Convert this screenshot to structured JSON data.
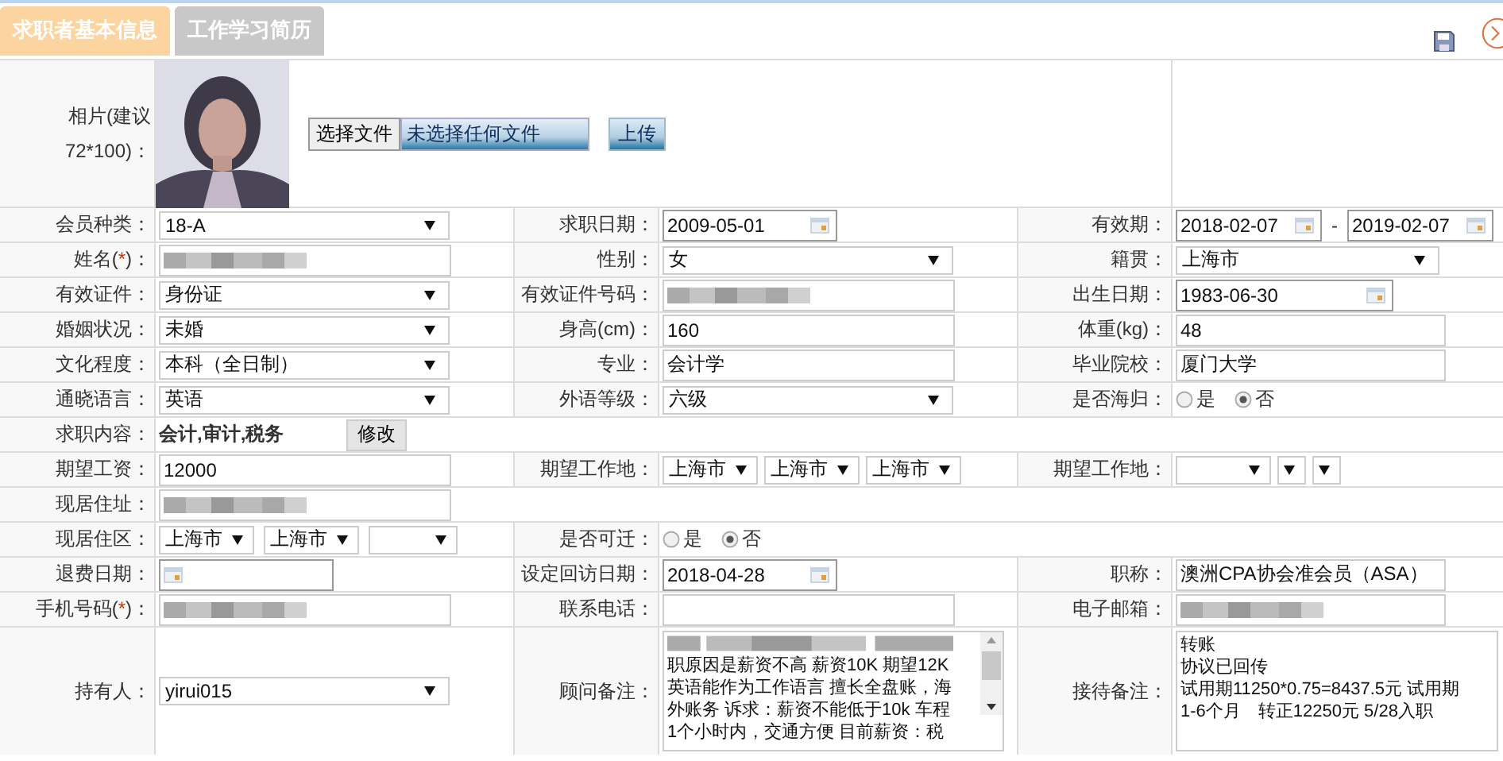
{
  "tabs": [
    {
      "label": "求职者基本信息",
      "selected": true
    },
    {
      "label": "工作学习简历",
      "selected": false
    }
  ],
  "photo": {
    "label_lines": [
      "相片(建议",
      "72*100)："
    ],
    "choose_button": "选择文件",
    "file_status": "未选择任何文件",
    "upload_button": "上传"
  },
  "rows": [
    [
      {
        "label": "会员种类：",
        "field": {
          "kind": "select",
          "value": "18-A"
        }
      },
      {
        "label": "求职日期：",
        "field": {
          "kind": "date",
          "value": "2009-05-01"
        }
      },
      {
        "label": "有效期：",
        "field": {
          "kind": "daterange",
          "from": "2018-02-07",
          "sep": "-",
          "to": "2019-02-07"
        }
      }
    ],
    [
      {
        "label": "姓名(",
        "required_mark": "*",
        "label_end": ")：",
        "field": {
          "kind": "redacted"
        }
      },
      {
        "label": "性别：",
        "field": {
          "kind": "select",
          "value": "女"
        }
      },
      {
        "label": "籍贯：",
        "field": {
          "kind": "select",
          "value": "上海市"
        }
      }
    ],
    [
      {
        "label": "有效证件：",
        "field": {
          "kind": "select",
          "value": "身份证"
        }
      },
      {
        "label": "有效证件号码：",
        "field": {
          "kind": "redacted"
        }
      },
      {
        "label": "出生日期：",
        "field": {
          "kind": "date",
          "value": "1983-06-30"
        }
      }
    ],
    [
      {
        "label": "婚姻状况：",
        "field": {
          "kind": "select",
          "value": "未婚"
        }
      },
      {
        "label": "身高(cm)：",
        "field": {
          "kind": "input",
          "value": "160"
        }
      },
      {
        "label": "体重(kg)：",
        "field": {
          "kind": "input",
          "value": "48"
        }
      }
    ],
    [
      {
        "label": "文化程度：",
        "field": {
          "kind": "select",
          "value": "本科（全日制）"
        }
      },
      {
        "label": "专业：",
        "field": {
          "kind": "input",
          "value": "会计学"
        }
      },
      {
        "label": "毕业院校：",
        "field": {
          "kind": "input",
          "value": "厦门大学"
        }
      }
    ],
    [
      {
        "label": "通晓语言：",
        "field": {
          "kind": "select",
          "value": "英语"
        }
      },
      {
        "label": "外语等级：",
        "field": {
          "kind": "select",
          "value": "六级"
        }
      },
      {
        "label": "是否海归：",
        "field": {
          "kind": "radio",
          "options": [
            {
              "label": "是",
              "selected": false
            },
            {
              "label": "否",
              "selected": true
            }
          ]
        }
      }
    ],
    [
      {
        "label": "求职内容：",
        "field": {
          "kind": "text_button",
          "text": "会计,审计,税务",
          "button": "修改"
        }
      }
    ],
    [
      {
        "label": "期望工资：",
        "field": {
          "kind": "input",
          "value": "12000"
        }
      },
      {
        "label": "期望工作地：",
        "field": {
          "kind": "selects",
          "items": [
            {
              "value": "上海市"
            },
            {
              "value": "上海市"
            },
            {
              "value": "上海市"
            }
          ]
        }
      },
      {
        "label": "期望工作地：",
        "field": {
          "kind": "selects",
          "items": [
            {
              "empty": true
            },
            {
              "empty": true
            },
            {
              "empty": true
            }
          ]
        }
      }
    ],
    [
      {
        "label": "现居住址：",
        "field": {
          "kind": "redacted"
        }
      }
    ],
    [
      {
        "label": "现居住区：",
        "field": {
          "kind": "selects",
          "items": [
            {
              "value": "上海市"
            },
            {
              "value": "上海市"
            },
            {
              "empty": true
            }
          ]
        }
      },
      {
        "label": "是否可迁：",
        "field": {
          "kind": "radio",
          "options": [
            {
              "label": "是",
              "selected": false
            },
            {
              "label": "否",
              "selected": true
            }
          ]
        }
      }
    ],
    [
      {
        "label": "退费日期：",
        "field": {
          "kind": "date"
        }
      },
      {
        "label": "设定回访日期：",
        "field": {
          "kind": "date",
          "value": "2018-04-28"
        }
      },
      {
        "label": "职称：",
        "field": {
          "kind": "input",
          "value": "澳洲CPA协会准会员（ASA）"
        }
      }
    ],
    [
      {
        "label": "手机号码(",
        "required_mark": "*",
        "label_end": ")：",
        "field": {
          "kind": "redacted"
        }
      },
      {
        "label": "联系电话：",
        "field": {
          "kind": "input"
        }
      },
      {
        "label": "电子邮箱：",
        "field": {
          "kind": "redacted"
        }
      }
    ],
    [
      {
        "label": "持有人：",
        "field": {
          "kind": "select",
          "value": "yirui015"
        }
      },
      {
        "label": "顾问备注：",
        "field": {
          "kind": "textarea",
          "redacted_first_line": true,
          "scrollbar": true,
          "lines": [
            "职原因是薪资不高 薪资10K 期望12K",
            "英语能作为工作语言 擅长全盘账，海",
            "外账务 诉求：薪资不能低于10k 车程",
            "1个小时内，交通方便 目前薪资：税"
          ]
        }
      },
      {
        "label": "接待备注：",
        "field": {
          "kind": "textarea",
          "lines": [
            "转账",
            "协议已回传",
            "试用期11250*0.75=8437.5元 试用期",
            "1-6个月　转正12250元 5/28入职"
          ]
        }
      }
    ]
  ]
}
